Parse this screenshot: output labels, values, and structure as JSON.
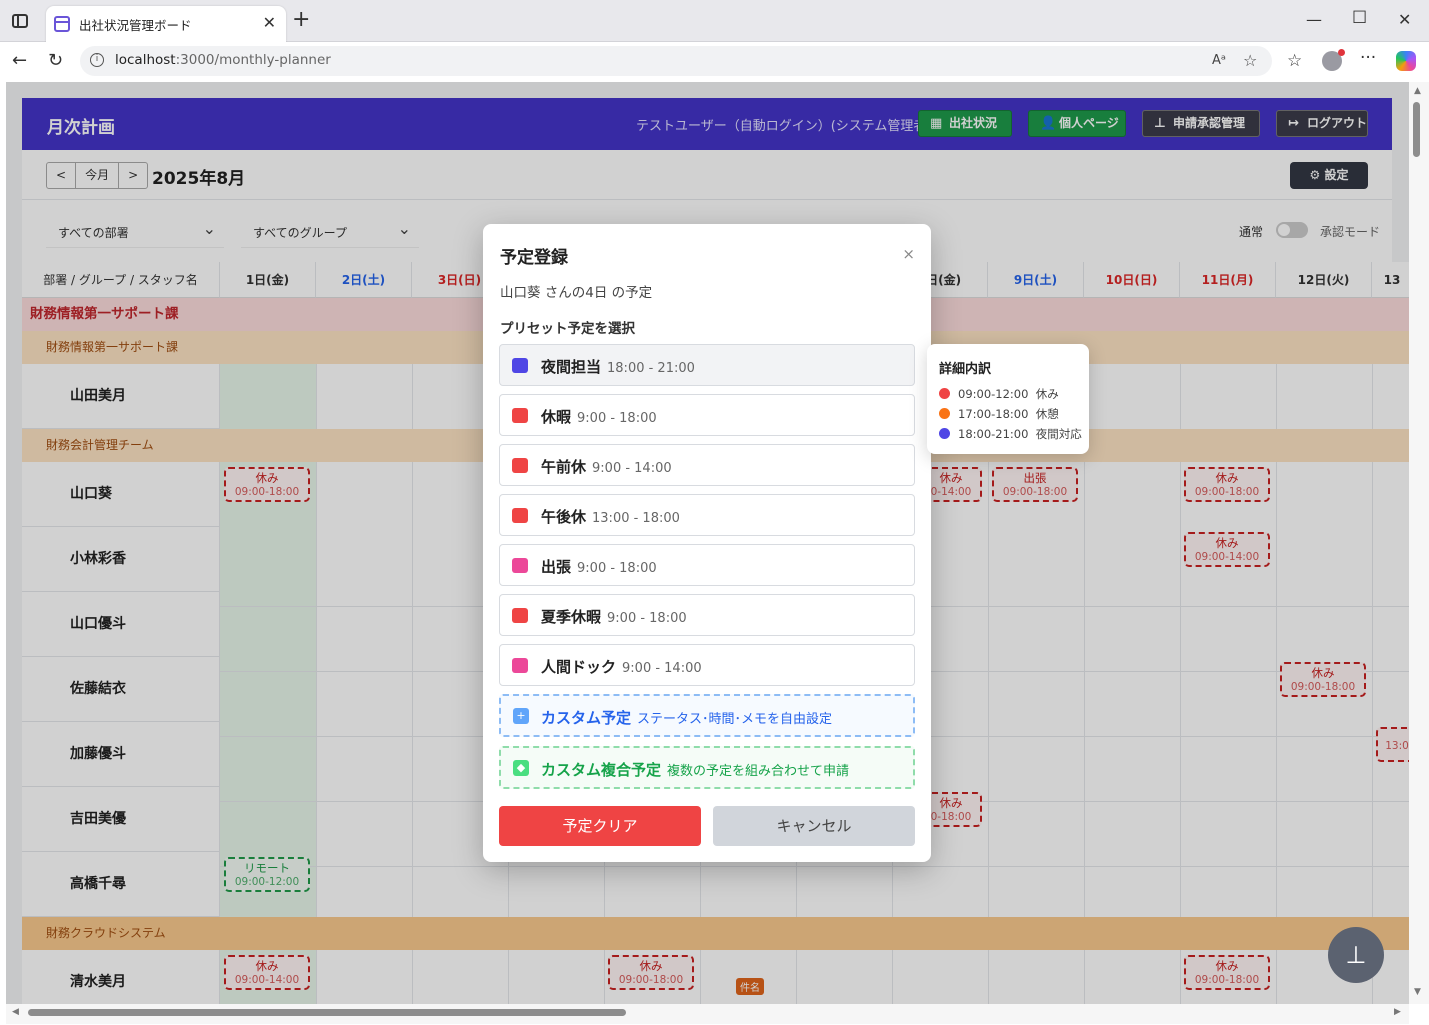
{
  "browser": {
    "tab_title": "出社状況管理ボード",
    "url_host": "localhost",
    "url_rest": ":3000/monthly-planner"
  },
  "header": {
    "title": "月次計画",
    "user": "テストユーザー（自動ログイン）(システム管理者)",
    "btn_attendance": "出社状況",
    "btn_personal": "個人ページ",
    "btn_approval": "申請承認管理",
    "btn_logout": "ログアウト"
  },
  "controls": {
    "prev": "<",
    "today": "今月",
    "next": ">",
    "month": "2025年8月",
    "settings": "設定"
  },
  "filters": {
    "dept": "すべての部署",
    "group": "すべてのグループ",
    "mode_normal": "通常",
    "mode_approval": "承認モード"
  },
  "grid": {
    "corner": "部署 / グループ / スタッフ名",
    "days": [
      "1日(金)",
      "2日(土)",
      "3日(日)",
      "",
      "",
      "",
      "",
      "8日(金)",
      "9日(土)",
      "10日(日)",
      "11日(月)",
      "12日(火)",
      "13"
    ],
    "dept": "財務情報第一サポート課",
    "team1": "財務情報第一サポート課",
    "team2": "財務会計管理チーム",
    "team3": "財務クラウドシステム",
    "staff": [
      "山田美月",
      "山口葵",
      "小林彩香",
      "山口優斗",
      "佐藤結衣",
      "加藤優斗",
      "吉田美優",
      "高橋千尋",
      "清水美月"
    ],
    "ev_rest": "休み",
    "ev_trip": "出張",
    "ev_remote": "リモート",
    "t_full": "09:00-18:00",
    "t_am": "09:00-14:00",
    "t_am2": "0-14:00",
    "t_full2": "0-18:00",
    "t_half": "09:00-12:00",
    "t_13": "13:0",
    "badge": "件名"
  },
  "modal": {
    "title": "予定登録",
    "close": "×",
    "subtitle": "山口葵 さんの4日 の予定",
    "section": "プリセット予定を選択",
    "presets": [
      {
        "name": "夜間担当",
        "time": "18:00 - 21:00",
        "color": "#4f46e5"
      },
      {
        "name": "休暇",
        "time": "9:00 - 18:00",
        "color": "#ef4444"
      },
      {
        "name": "午前休",
        "time": "9:00 - 14:00",
        "color": "#ef4444"
      },
      {
        "name": "午後休",
        "time": "13:00 - 18:00",
        "color": "#ef4444"
      },
      {
        "name": "出張",
        "time": "9:00 - 18:00",
        "color": "#ec4899"
      },
      {
        "name": "夏季休暇",
        "time": "9:00 - 18:00",
        "color": "#ef4444"
      },
      {
        "name": "人間ドック",
        "time": "9:00 - 14:00",
        "color": "#ec4899"
      }
    ],
    "custom_name": "カスタム予定",
    "custom_desc": "ステータス･時間･メモを自由設定",
    "compound_name": "カスタム複合予定",
    "compound_desc": "複数の予定を組み合わせて申請",
    "clear": "予定クリア",
    "cancel": "キャンセル"
  },
  "tooltip": {
    "title": "詳細内訳",
    "rows": [
      {
        "time": "09:00-12:00",
        "label": "休み",
        "color": "#ef4444"
      },
      {
        "time": "17:00-18:00",
        "label": "休憩",
        "color": "#f97316"
      },
      {
        "time": "18:00-21:00",
        "label": "夜間対応",
        "color": "#4f46e5"
      }
    ]
  }
}
